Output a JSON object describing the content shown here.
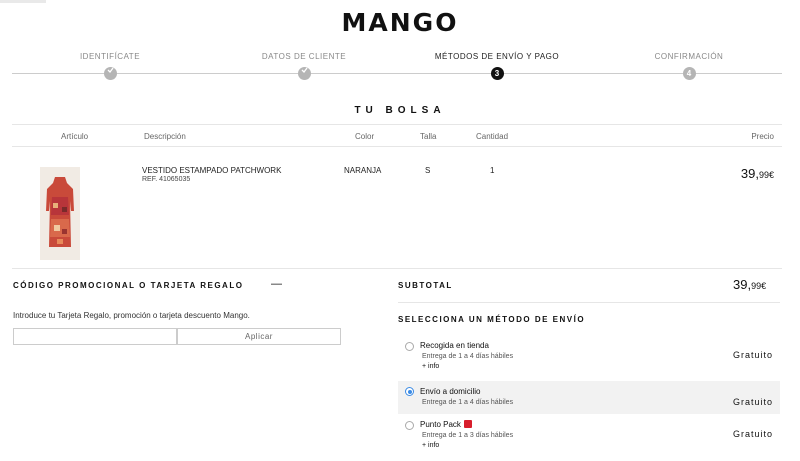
{
  "brand": {
    "logo": "MANGO"
  },
  "steps": [
    {
      "label": "IDENTIFÍCATE",
      "state": "done",
      "number": ""
    },
    {
      "label": "DATOS DE CLIENTE",
      "state": "done",
      "number": ""
    },
    {
      "label": "MÉTODOS DE ENVÍO Y PAGO",
      "state": "active",
      "number": "3"
    },
    {
      "label": "CONFIRMACIÓN",
      "state": "pending",
      "number": "4"
    }
  ],
  "bag": {
    "title": "TU BOLSA",
    "headers": {
      "article": "Artículo",
      "description": "Descripción",
      "color": "Color",
      "size": "Talla",
      "quantity": "Cantidad",
      "price": "Precio"
    },
    "item": {
      "name": "VESTIDO ESTAMPADO PATCHWORK",
      "ref": "REF. 41065035",
      "color": "NARANJA",
      "size": "S",
      "quantity": "1",
      "price_int": "39,",
      "price_dec": "99",
      "currency": "€"
    }
  },
  "promo": {
    "title": "CÓDIGO PROMOCIONAL O TARJETA REGALO",
    "toggle": "—",
    "description": "Introduce tu Tarjeta Regalo, promoción o tarjeta descuento Mango.",
    "input_value": "",
    "apply_label": "Aplicar"
  },
  "summary": {
    "subtotal_label": "SUBTOTAL",
    "subtotal_int": "39,",
    "subtotal_dec": "99",
    "currency": "€"
  },
  "shipping": {
    "title": "SELECCIONA UN MÉTODO DE ENVÍO",
    "options": [
      {
        "name": "Recogida en tienda",
        "days": "Entrega de 1 a 4 días hábiles",
        "info": "+ info",
        "price": "Gratuito",
        "selected": false
      },
      {
        "name": "Envío a domicilio",
        "days": "Entrega de 1 a 4 días hábiles",
        "info": "",
        "price": "Gratuito",
        "selected": true
      },
      {
        "name": "Punto Pack",
        "days": "Entrega de 1 a 3 días hábiles",
        "info": "+ info",
        "price": "Gratuito",
        "selected": false
      }
    ]
  },
  "colors": {
    "accent_radio": "#3b8be5",
    "pack_icon": "#d81e2c",
    "active_step": "#111111",
    "inactive_step": "#b5b5b5"
  }
}
